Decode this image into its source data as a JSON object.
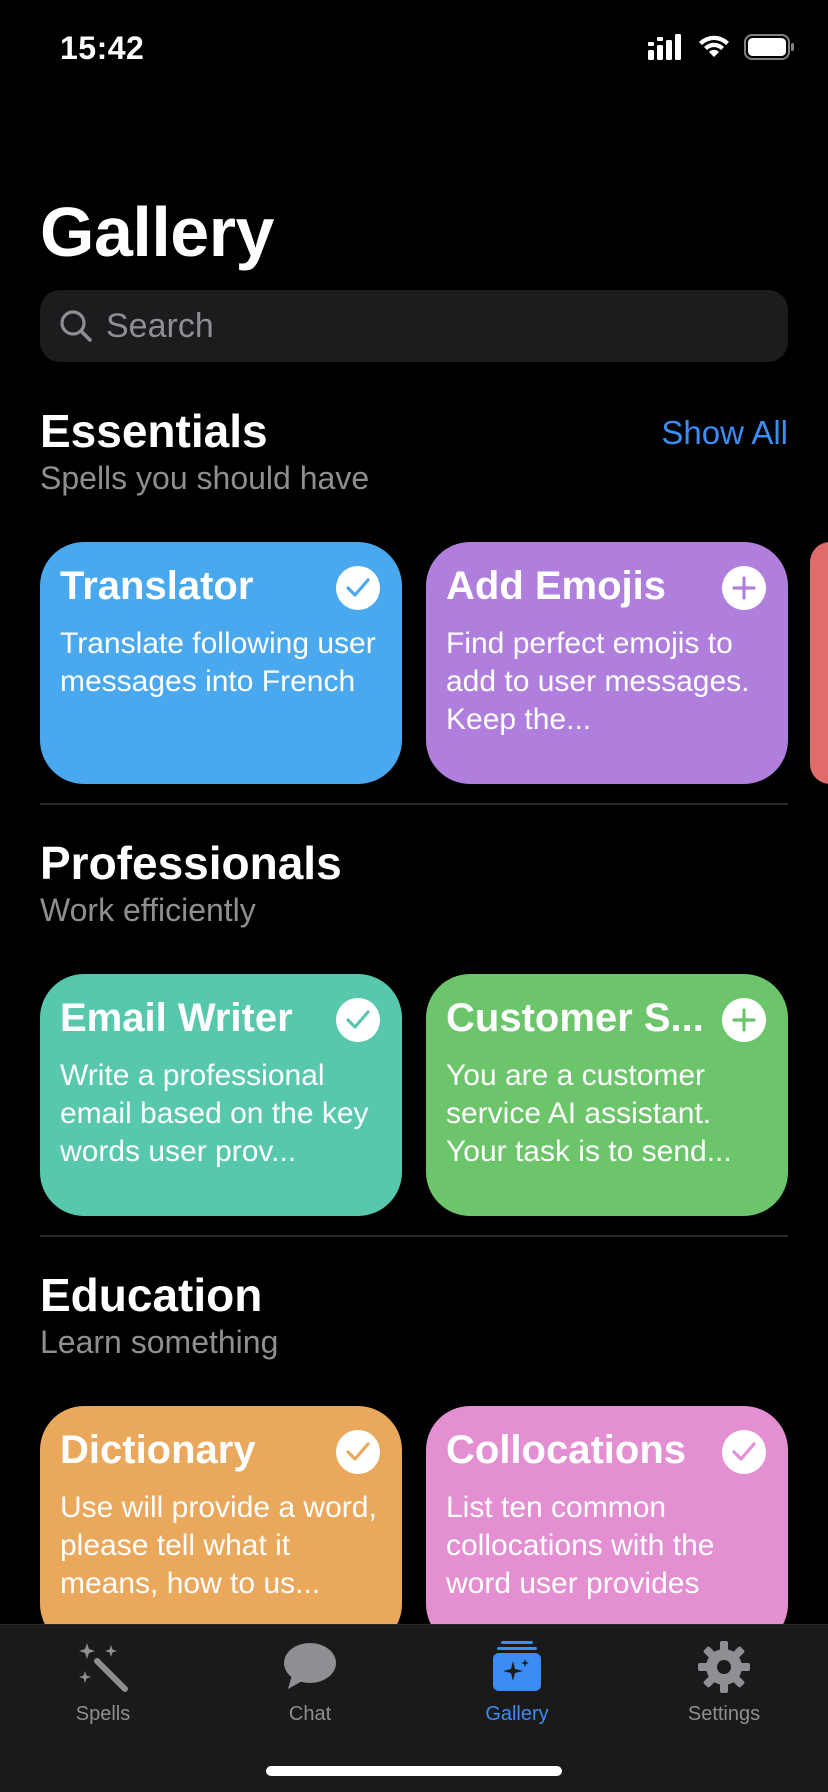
{
  "status_bar": {
    "time": "15:42"
  },
  "header": {
    "title": "Gallery"
  },
  "search": {
    "placeholder": "Search"
  },
  "sections": [
    {
      "title": "Essentials",
      "subtitle": "Spells you should have",
      "show_all_label": "Show All",
      "cards": [
        {
          "title": "Translator",
          "description": "Translate following user messages into French",
          "color": "#4aa8ee",
          "state": "added",
          "badge_icon": "checkmark-icon"
        },
        {
          "title": "Add Emojis",
          "description": "Find perfect emojis to add to user messages. Keep the...",
          "color": "#b07fde",
          "state": "not-added",
          "badge_icon": "plus-icon"
        }
      ],
      "partial_card_color": "#e06b6b"
    },
    {
      "title": "Professionals",
      "subtitle": "Work efficiently",
      "cards": [
        {
          "title": "Email Writer",
          "description": "Write a professional email based on the key words user prov...",
          "color": "#57c8ac",
          "state": "added",
          "badge_icon": "checkmark-icon"
        },
        {
          "title": "Customer S...",
          "description": "You are a customer service AI assistant. Your task is to send...",
          "color": "#6cc56a",
          "state": "not-added",
          "badge_icon": "plus-icon"
        }
      ]
    },
    {
      "title": "Education",
      "subtitle": "Learn something",
      "cards": [
        {
          "title": "Dictionary",
          "description": "Use will provide a word, please tell what it means, how to us...",
          "color": "#e9a85c",
          "state": "added",
          "badge_icon": "checkmark-icon"
        },
        {
          "title": "Collocations",
          "description": "List ten common collocations with the word user provides",
          "color": "#e38fd2",
          "state": "added",
          "badge_icon": "checkmark-icon"
        }
      ]
    }
  ],
  "tab_bar": {
    "tabs": [
      {
        "label": "Spells",
        "icon": "magic-wand-icon",
        "active": false
      },
      {
        "label": "Chat",
        "icon": "chat-bubble-icon",
        "active": false
      },
      {
        "label": "Gallery",
        "icon": "gallery-icon",
        "active": true
      },
      {
        "label": "Settings",
        "icon": "gear-icon",
        "active": false
      }
    ]
  },
  "colors": {
    "accent": "#3b8cf5",
    "background": "#000000",
    "secondary_text": "#8e8e93"
  }
}
